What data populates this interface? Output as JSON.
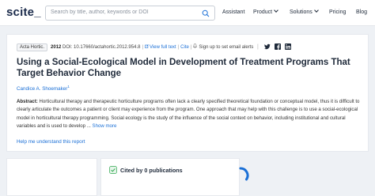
{
  "header": {
    "logo": "scite",
    "logo_suffix": "_",
    "search": {
      "placeholder": "Search by title, author, keywords or DOI"
    },
    "nav": [
      {
        "label": "Assistant",
        "has_dropdown": false
      },
      {
        "label": "Product",
        "has_dropdown": true
      },
      {
        "label": "Solutions",
        "has_dropdown": true
      },
      {
        "label": "Pricing",
        "has_dropdown": false
      },
      {
        "label": "Blog",
        "has_dropdown": false
      }
    ]
  },
  "article": {
    "journal": "Acta Hortic.",
    "year": "2012",
    "doi": "DOI: 10.17660/actahortic.2012.954.8",
    "view_full_text": "View full text",
    "cite": "Cite",
    "alerts": "Sign up to set email alerts",
    "social_icons": [
      "twitter-icon",
      "facebook-icon",
      "linkedin-icon"
    ],
    "title": "Using a Social-Ecological Model in Development of Treatment Programs That Target Behavior Change",
    "author": "Candice A. Shoemaker",
    "author_sup": "1",
    "abstract_label": "Abstract:",
    "abstract_text": " Horticultural therapy and therapeutic horticulture programs often lack a clearly specified theoretical foundation or conceptual model, thus it is difficult to clearly articulate the outcomes a patient or client may experience from the program. One approach that may help with this challenge is to use a social-ecological model in horticultural therapy programming. Social ecology is the study of the influence of the social context on behavior, including institutional and cultural variables and is used to develop ...",
    "show_more": " Show more",
    "help_link": "Help me understand this report"
  },
  "citations": {
    "label": "Cited by 0 publications"
  },
  "colors": {
    "accent": "#1a6fd6",
    "title": "#1f2a3a",
    "cited_icon": "#2fa84f",
    "spinner": "#1a6fd6",
    "background": "#eef1f5"
  }
}
